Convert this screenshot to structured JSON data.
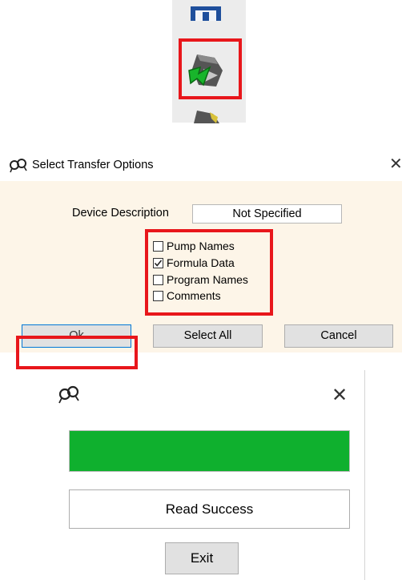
{
  "toolbar": {
    "icons": [
      "save-icon",
      "transfer-icon",
      "transfer-icon"
    ]
  },
  "transfer_dialog": {
    "title": "Select Transfer Options",
    "close_glyph": "✕",
    "device_description_label": "Device Description",
    "device_description_value": "Not Specified",
    "options": [
      {
        "label": "Pump Names",
        "checked": false
      },
      {
        "label": "Formula Data",
        "checked": true
      },
      {
        "label": "Program Names",
        "checked": false
      },
      {
        "label": "Comments",
        "checked": false
      }
    ],
    "buttons": {
      "ok": "Ok",
      "select_all": "Select All",
      "cancel": "Cancel"
    }
  },
  "status_dialog": {
    "close_glyph": "✕",
    "progress": 1.0,
    "status_text": "Read Success",
    "exit_label": "Exit"
  },
  "colors": {
    "highlight": "#e8161b",
    "progress": "#0fb02e",
    "dialog_background": "#fdf5e8"
  }
}
